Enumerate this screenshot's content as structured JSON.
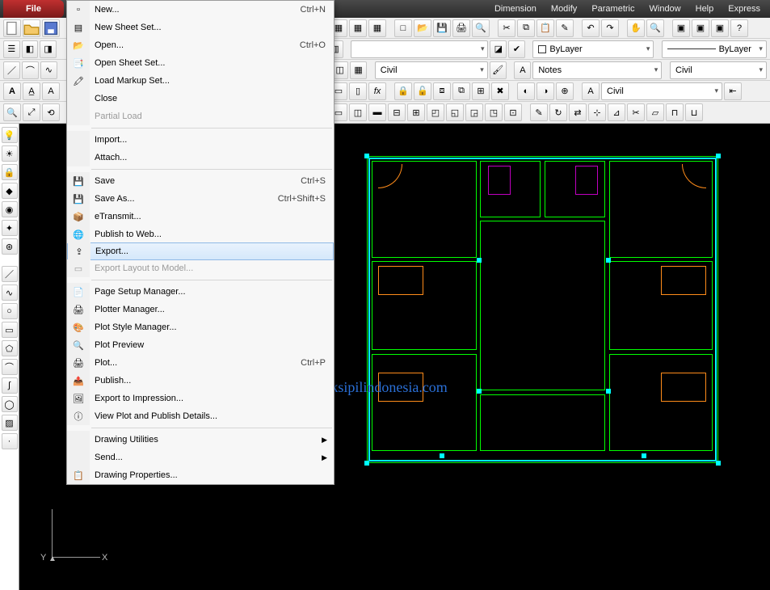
{
  "titlebar": {
    "app_label": "File"
  },
  "menubar": {
    "dimension": "Dimension",
    "modify": "Modify",
    "parametric": "Parametric",
    "window": "Window",
    "help": "Help",
    "express": "Express"
  },
  "dropdowns": {
    "bylayer": "ByLayer",
    "bylayer2": "ByLayer",
    "civil": "Civil",
    "notes": "Notes",
    "civil2": "Civil",
    "civil3": "Civil"
  },
  "file_menu": {
    "new": "New...",
    "new_key": "Ctrl+N",
    "new_sheet_set": "New Sheet Set...",
    "open": "Open...",
    "open_key": "Ctrl+O",
    "open_sheet": "Open Sheet Set...",
    "load_markup": "Load Markup Set...",
    "close": "Close",
    "partial_load": "Partial Load",
    "import": "Import...",
    "attach": "Attach...",
    "save": "Save",
    "save_key": "Ctrl+S",
    "save_as": "Save As...",
    "save_as_key": "Ctrl+Shift+S",
    "etransmit": "eTransmit...",
    "publish_web": "Publish to Web...",
    "export": "Export...",
    "export_layout": "Export Layout to Model...",
    "page_setup": "Page Setup Manager...",
    "plotter_mgr": "Plotter Manager...",
    "plot_style": "Plot Style Manager...",
    "plot_preview": "Plot Preview",
    "plot": "Plot...",
    "plot_key": "Ctrl+P",
    "publish": "Publish...",
    "export_impression": "Export to Impression...",
    "view_plot_details": "View Plot and Publish Details...",
    "drawing_utilities": "Drawing Utilities",
    "send": "Send...",
    "drawing_properties": "Drawing Properties..."
  },
  "watermark": "www.ilmutekniksipilindonesia.com",
  "ucs": {
    "x": "X",
    "y": "Y"
  }
}
